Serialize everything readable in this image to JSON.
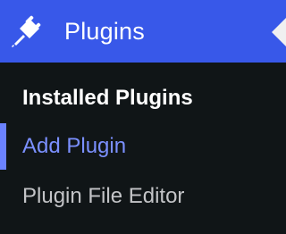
{
  "menu": {
    "title": "Plugins",
    "icon": "plug-icon",
    "accent_color": "#3858e9",
    "submenu_items": [
      {
        "label": "Installed Plugins",
        "state": "current"
      },
      {
        "label": "Add Plugin",
        "state": "focused"
      },
      {
        "label": "Plugin File Editor",
        "state": "default"
      }
    ]
  }
}
